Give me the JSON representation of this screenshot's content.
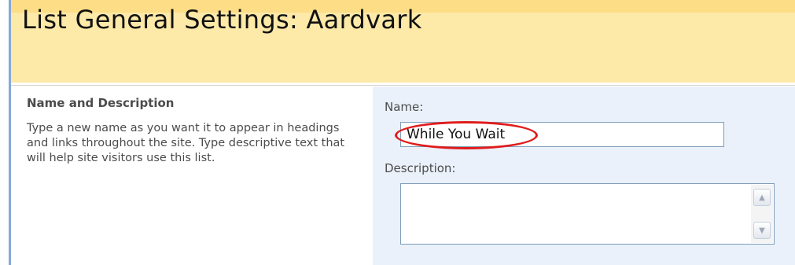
{
  "page": {
    "title": "List General Settings: Aardvark"
  },
  "section": {
    "heading": "Name and Description",
    "description": "Type a new name as you want it to appear in headings and links throughout the site. Type descriptive text that will help site visitors use this list."
  },
  "form": {
    "name_label": "Name:",
    "name_value": "While You Wait",
    "description_label": "Description:",
    "description_value": ""
  },
  "icons": {
    "scroll_up": "scroll-up-arrow-icon",
    "scroll_down": "scroll-down-arrow-icon",
    "scroll_up_glyph": "▲",
    "scroll_down_glyph": "▼"
  },
  "colors": {
    "title_band": "#fde9a8",
    "form_panel": "#eaf1fa",
    "highlight_oval": "#e11b1b",
    "left_edge_line": "#86a9d6"
  }
}
